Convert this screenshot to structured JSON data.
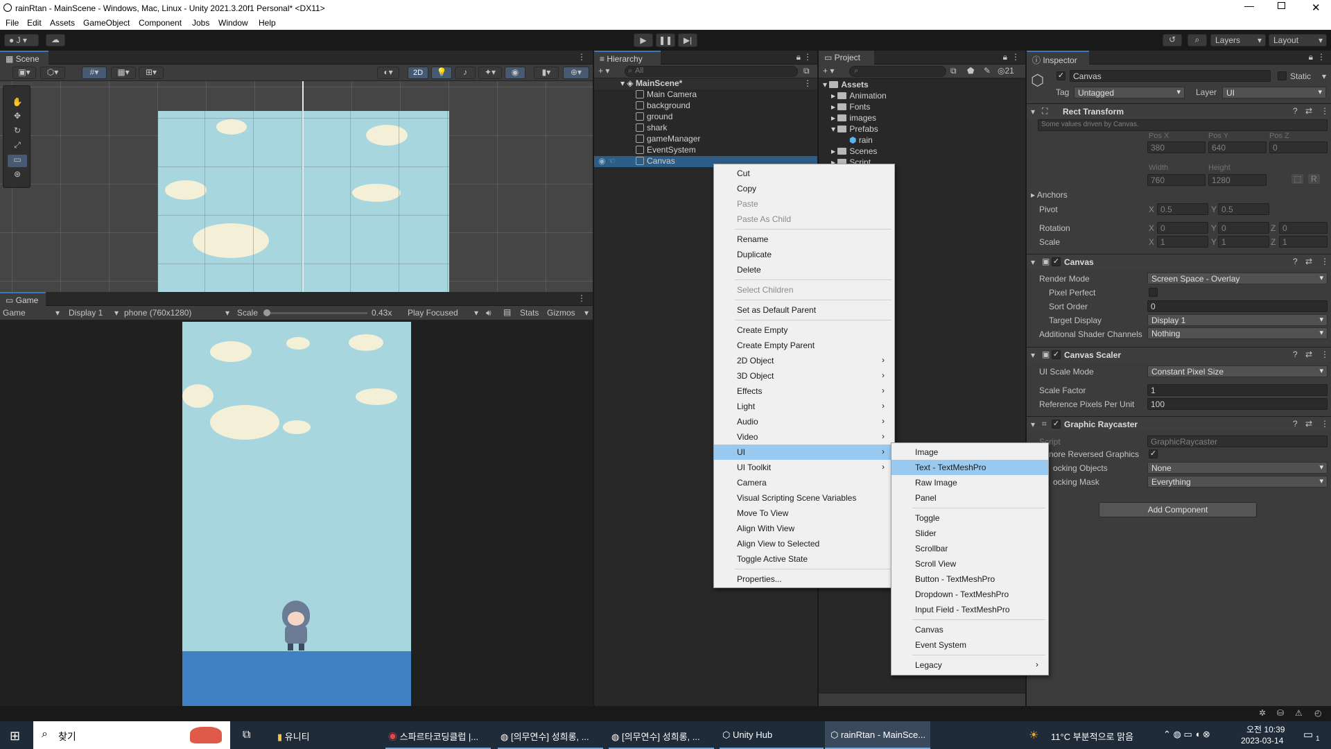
{
  "window": {
    "title": "rainRtan - MainScene - Windows, Mac, Linux - Unity 2021.3.20f1 Personal* <DX11>"
  },
  "menu": [
    "File",
    "Edit",
    "Assets",
    "GameObject",
    "Component",
    "Jobs",
    "Window",
    "Help"
  ],
  "toolbar": {
    "account": "J",
    "layers": "Layers",
    "layout": "Layout"
  },
  "scene": {
    "tab": "Scene",
    "mode2d": "2D"
  },
  "game": {
    "tab": "Game",
    "view": "Game",
    "display": "Display 1",
    "resolution": "phone (760x1280)",
    "scale_label": "Scale",
    "scale_value": "0.43x",
    "play_mode": "Play Focused",
    "stats": "Stats",
    "gizmos": "Gizmos"
  },
  "hierarchy": {
    "tab": "Hierarchy",
    "search_placeholder": "All",
    "scene": "MainScene*",
    "items": [
      "Main Camera",
      "background",
      "ground",
      "shark",
      "gameManager",
      "EventSystem",
      "Canvas"
    ]
  },
  "project": {
    "tab": "Project",
    "count": "21",
    "root": "Assets",
    "items": [
      "Animation",
      "Fonts",
      "images",
      "Prefabs",
      "rain",
      "Scenes",
      "Script"
    ]
  },
  "context_menu": {
    "items": [
      "Cut",
      "Copy",
      "Paste",
      "Paste As Child",
      "Rename",
      "Duplicate",
      "Delete",
      "Select Children",
      "Set as Default Parent",
      "Create Empty",
      "Create Empty Parent",
      "2D Object",
      "3D Object",
      "Effects",
      "Light",
      "Audio",
      "Video",
      "UI",
      "UI Toolkit",
      "Camera",
      "Visual Scripting Scene Variables",
      "Move To View",
      "Align With View",
      "Align View to Selected",
      "Toggle Active State",
      "Properties..."
    ]
  },
  "ui_submenu": {
    "items": [
      "Image",
      "Text - TextMeshPro",
      "Raw Image",
      "Panel",
      "Toggle",
      "Slider",
      "Scrollbar",
      "Scroll View",
      "Button - TextMeshPro",
      "Dropdown - TextMeshPro",
      "Input Field - TextMeshPro",
      "Canvas",
      "Event System",
      "Legacy"
    ]
  },
  "inspector": {
    "tab": "Inspector",
    "object_name": "Canvas",
    "static": "Static",
    "tag_label": "Tag",
    "tag": "Untagged",
    "layer_label": "Layer",
    "layer": "UI",
    "rect": {
      "title": "Rect Transform",
      "note": "Some values driven by Canvas.",
      "posx_l": "Pos X",
      "posy_l": "Pos Y",
      "posz_l": "Pos Z",
      "posx": "380",
      "posy": "640",
      "posz": "0",
      "width_l": "Width",
      "height_l": "Height",
      "width": "760",
      "height": "1280",
      "anchors": "Anchors",
      "pivot": "Pivot",
      "pivot_x": "0.5",
      "pivot_y": "0.5",
      "rotation": "Rotation",
      "rot_x": "0",
      "rot_y": "0",
      "rot_z": "0",
      "scale": "Scale",
      "scale_x": "1",
      "scale_y": "1",
      "scale_z": "1",
      "x": "X",
      "y": "Y",
      "z": "Z"
    },
    "canvas": {
      "title": "Canvas",
      "render_mode_l": "Render Mode",
      "render_mode": "Screen Space - Overlay",
      "pixel_perfect": "Pixel Perfect",
      "sort_order_l": "Sort Order",
      "sort_order": "0",
      "target_display_l": "Target Display",
      "target_display": "Display 1",
      "shader_l": "Additional Shader Channels",
      "shader": "Nothing"
    },
    "scaler": {
      "title": "Canvas Scaler",
      "mode_l": "UI Scale Mode",
      "mode": "Constant Pixel Size",
      "factor_l": "Scale Factor",
      "factor": "1",
      "ref_l": "Reference Pixels Per Unit",
      "ref": "100"
    },
    "raycaster": {
      "title": "Graphic Raycaster",
      "script_l": "Script",
      "script": "GraphicRaycaster",
      "ignore_l": "nore Reversed Graphics",
      "blocking_l": "ocking Objects",
      "blocking": "None",
      "mask_l": "ocking Mask",
      "mask": "Everything"
    },
    "add_component": "Add Component"
  },
  "taskbar": {
    "search": "찾기",
    "apps": [
      "유니티",
      "스파르타코딩클럽 |...",
      "[의무연수] 성희롱, ...",
      "[의무연수] 성희롱, ...",
      "Unity Hub",
      "rainRtan - MainSce..."
    ],
    "weather": "11°C 부분적으로 맑음",
    "time": "오전 10:39",
    "date": "2023-03-14",
    "notif": "1"
  }
}
